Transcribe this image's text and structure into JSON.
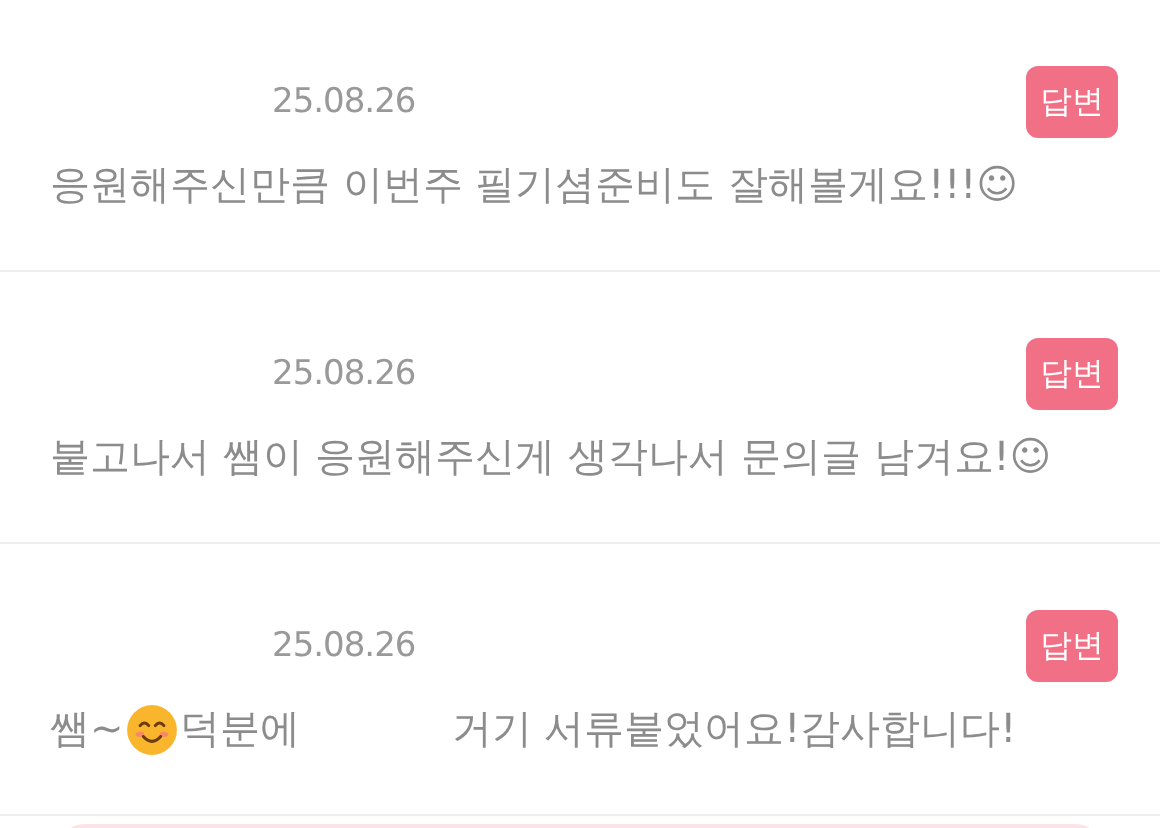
{
  "comments": [
    {
      "date": "25.08.26",
      "badge": "답변",
      "segments": [
        {
          "kind": "text",
          "text": "응원해주신만큼 이번주 필기셤준비도 잘해볼게요!!!☺"
        }
      ]
    },
    {
      "date": "25.08.26",
      "badge": "답변",
      "segments": [
        {
          "kind": "text",
          "text": "붙고나서 쌤이 응원해주신게 생각나서 문의글 남겨요!☺"
        }
      ]
    },
    {
      "date": "25.08.26",
      "badge": "답변",
      "segments": [
        {
          "kind": "text",
          "text": "쌤~"
        },
        {
          "kind": "emoji"
        },
        {
          "kind": "text",
          "text": "덕분에"
        },
        {
          "kind": "gap"
        },
        {
          "kind": "text",
          "text": "거기 서류붙었어요!감사합니다!"
        }
      ]
    }
  ]
}
